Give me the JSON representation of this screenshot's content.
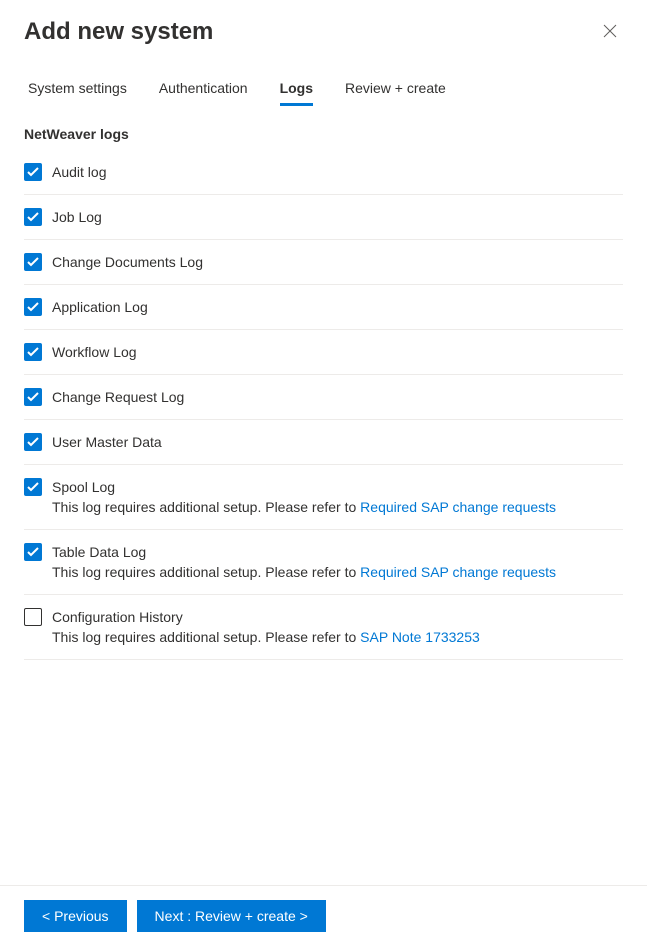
{
  "title": "Add new system",
  "tabs": [
    {
      "label": "System settings",
      "active": false
    },
    {
      "label": "Authentication",
      "active": false
    },
    {
      "label": "Logs",
      "active": true
    },
    {
      "label": "Review + create",
      "active": false
    }
  ],
  "section": {
    "heading": "NetWeaver logs",
    "logs": [
      {
        "label": "Audit log",
        "checked": true,
        "desc": "",
        "link": ""
      },
      {
        "label": "Job Log",
        "checked": true,
        "desc": "",
        "link": ""
      },
      {
        "label": "Change Documents Log",
        "checked": true,
        "desc": "",
        "link": ""
      },
      {
        "label": "Application Log",
        "checked": true,
        "desc": "",
        "link": ""
      },
      {
        "label": "Workflow Log",
        "checked": true,
        "desc": "",
        "link": ""
      },
      {
        "label": "Change Request Log",
        "checked": true,
        "desc": "",
        "link": ""
      },
      {
        "label": "User Master Data",
        "checked": true,
        "desc": "",
        "link": ""
      },
      {
        "label": "Spool Log",
        "checked": true,
        "desc": "This log requires additional setup. Please refer to ",
        "link": "Required SAP change requests"
      },
      {
        "label": "Table Data Log",
        "checked": true,
        "desc": "This log requires additional setup. Please refer to ",
        "link": "Required SAP change requests"
      },
      {
        "label": "Configuration History",
        "checked": false,
        "desc": "This log requires additional setup. Please refer to ",
        "link": "SAP Note 1733253"
      }
    ]
  },
  "footer": {
    "previous": "< Previous",
    "next": "Next : Review + create >"
  }
}
